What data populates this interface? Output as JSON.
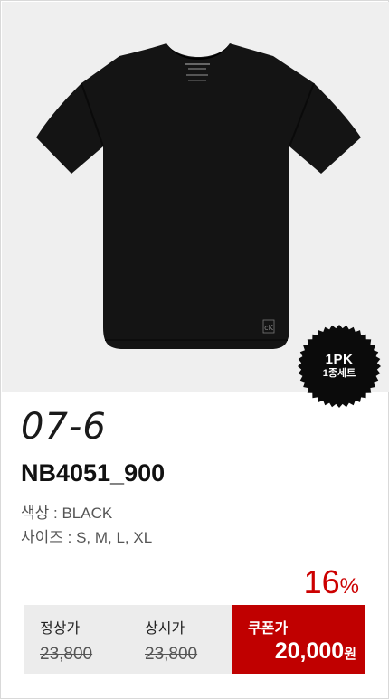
{
  "product": {
    "code": "07-6",
    "model": "NB4051_900",
    "color_label": "색상 : BLACK",
    "size_label": "사이즈 : S, M, L, XL"
  },
  "badge": {
    "line1": "1PK",
    "line2": "1종세트"
  },
  "discount": {
    "value": "16",
    "unit": "%"
  },
  "prices": {
    "regular_label": "정상가",
    "regular_price": "23,800",
    "store_label": "상시가",
    "store_price": "23,800",
    "coupon_label": "쿠폰가",
    "coupon_price": "20,000",
    "coupon_unit": "원"
  },
  "colors": {
    "accent": "#cc0000",
    "photo_bg": "#efefef",
    "shirt": "#141414"
  },
  "icons": [
    "black-tshirt-image",
    "calvin-klein-logo-icon",
    "pack-badge-icon"
  ]
}
